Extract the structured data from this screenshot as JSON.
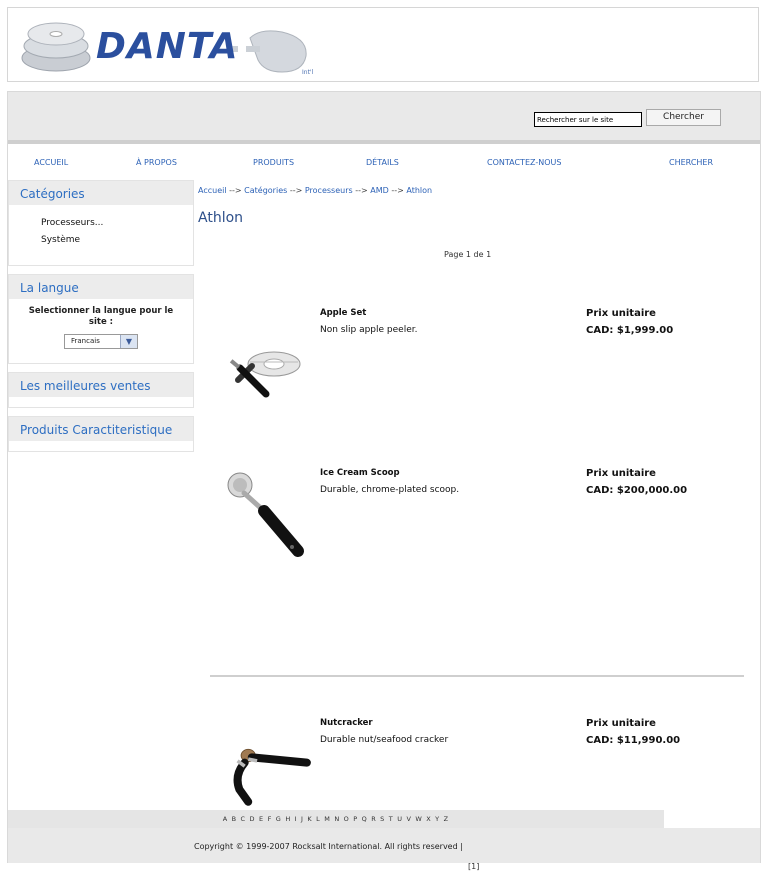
{
  "brand": {
    "logo_text": "DANTA",
    "logo_suffix": "Int'l"
  },
  "search": {
    "placeholder": "Rechercher sur le site",
    "button_label": "Chercher"
  },
  "nav": [
    "ACCUEIL",
    "À PROPOS",
    "PRODUITS",
    "DÉTAILS",
    "CONTACTEZ-NOUS",
    "CHERCHER"
  ],
  "sidebar": {
    "categories_title": "Catégories",
    "categories": [
      "Processeurs...",
      "Système"
    ],
    "language_title": "La langue",
    "language_text": "Selectionner la langue pour le site :",
    "language_selected": "Francais",
    "bestsellers_title": "Les meilleures ventes",
    "featured_title": "Produits Caractiteristique"
  },
  "breadcrumb": {
    "items": [
      "Accueil",
      "Catégories",
      "Processeurs",
      "AMD",
      "Athlon"
    ],
    "separator": "-->"
  },
  "page_title": "Athlon",
  "page_info": "Page 1 de 1",
  "products": [
    {
      "name": "Apple Set",
      "description": "Non slip apple peeler.",
      "price_label": "Prix unitaire",
      "price": "CAD: $1,999.00"
    },
    {
      "name": "Ice Cream Scoop",
      "description": "Durable, chrome-plated scoop.",
      "price_label": "Prix unitaire",
      "price": "CAD: $200,000.00"
    },
    {
      "name": "Nutcracker",
      "description": "Durable nut/seafood cracker",
      "price_label": "Prix unitaire",
      "price": "CAD: $11,990.00"
    }
  ],
  "pager": "[1]",
  "alphabet": "A B C D E F G H I J K L M N O P Q R S T U V W X Y Z",
  "footer": {
    "copyright": "Copyright © 1999-2007 Rocksalt International. All rights reserved |"
  },
  "colors": {
    "link": "#2d62b6",
    "heading": "#2d6ec2",
    "logo": "#2b4f9e",
    "panel": "#ececec"
  }
}
